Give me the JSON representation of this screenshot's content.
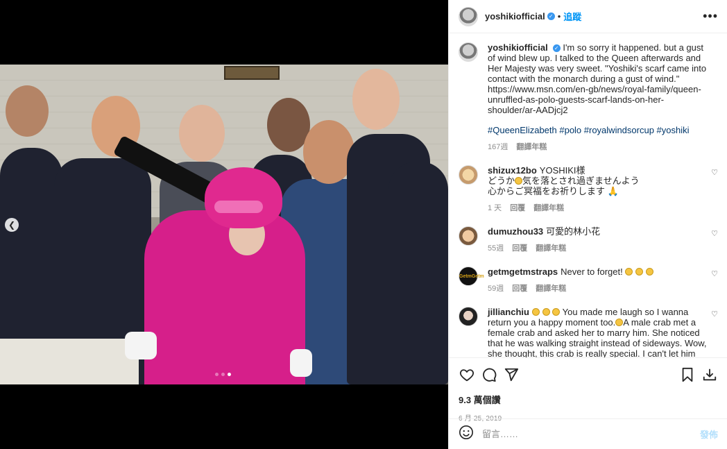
{
  "post": {
    "username": "yoshikiofficial",
    "follow_label": "追蹤",
    "more_label": "•••"
  },
  "caption": {
    "username": "yoshikiofficial",
    "text": "I'm so sorry it happened. but a gust of wind blew up. I talked to the Queen afterwards and Her Majesty was very sweet. \"Yoshiki's scarf came into contact with the monarch during a gust of wind.\" https://www.msn.com/en-gb/news/royal-family/queen-unruffled-as-polo-guests-scarf-lands-on-her-shoulder/ar-AADjcj2",
    "hashtags": "#QueenElizabeth #polo #royalwindsorcup #yoshiki",
    "time": "167週",
    "translate": "翻譯年糕"
  },
  "comments": [
    {
      "username": "shizux12bo",
      "text_line1": "YOSHIKI様",
      "text_line2a": "どうか",
      "text_line2b": "気を落とされ過ぎませんよう",
      "text_line3": "心からご冥福をお祈りします",
      "time": "1 天",
      "reply": "回覆",
      "translate": "翻譯年糕"
    },
    {
      "username": "dumuzhou33",
      "text": "可愛的林小花",
      "time": "55週",
      "reply": "回覆",
      "translate": "翻譯年糕"
    },
    {
      "username": "getmgetmstraps",
      "text": "Never to forget!",
      "avatar_text": "GetmGetm",
      "time": "59週",
      "reply": "回覆",
      "translate": "翻譯年糕"
    },
    {
      "username": "jillianchiu",
      "text_a": "You made me laugh so I wanna return you a happy moment too.",
      "text_b": "A male crab met a female crab and asked her to marry him. She noticed that he was walking straight instead of sideways. Wow, she thought, this crab is really special. I can't let him get away. So they got married happily ever after."
    }
  ],
  "stats": {
    "likes": "9.3 萬個讚",
    "date": "6 月 25, 2019"
  },
  "add_comment": {
    "placeholder": "留言……",
    "post_label": "發佈"
  },
  "colors": {
    "accent": "#0095f6",
    "link": "#00376b",
    "queen_pink": "#d61f8a"
  }
}
